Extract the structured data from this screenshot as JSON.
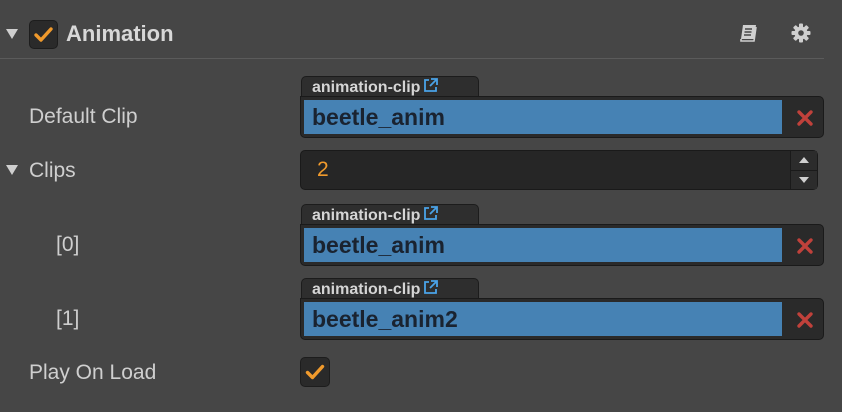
{
  "component": {
    "title": "Animation",
    "enabled": true,
    "icons": {
      "help": "book-icon",
      "settings": "gear-icon"
    }
  },
  "props": {
    "default_clip": {
      "label": "Default Clip",
      "asset_type": "animation-clip",
      "value": "beetle_anim"
    },
    "clips": {
      "label": "Clips",
      "count": "2",
      "items": [
        {
          "label": "[0]",
          "asset_type": "animation-clip",
          "value": "beetle_anim"
        },
        {
          "label": "[1]",
          "asset_type": "animation-clip",
          "value": "beetle_anim2"
        }
      ]
    },
    "play_on_load": {
      "label": "Play On Load",
      "checked": true
    }
  },
  "colors": {
    "accent_orange": "#f09a2c",
    "asset_blue": "#4682b4",
    "clear_red": "#c0413b",
    "link_blue": "#4aa3e8"
  }
}
